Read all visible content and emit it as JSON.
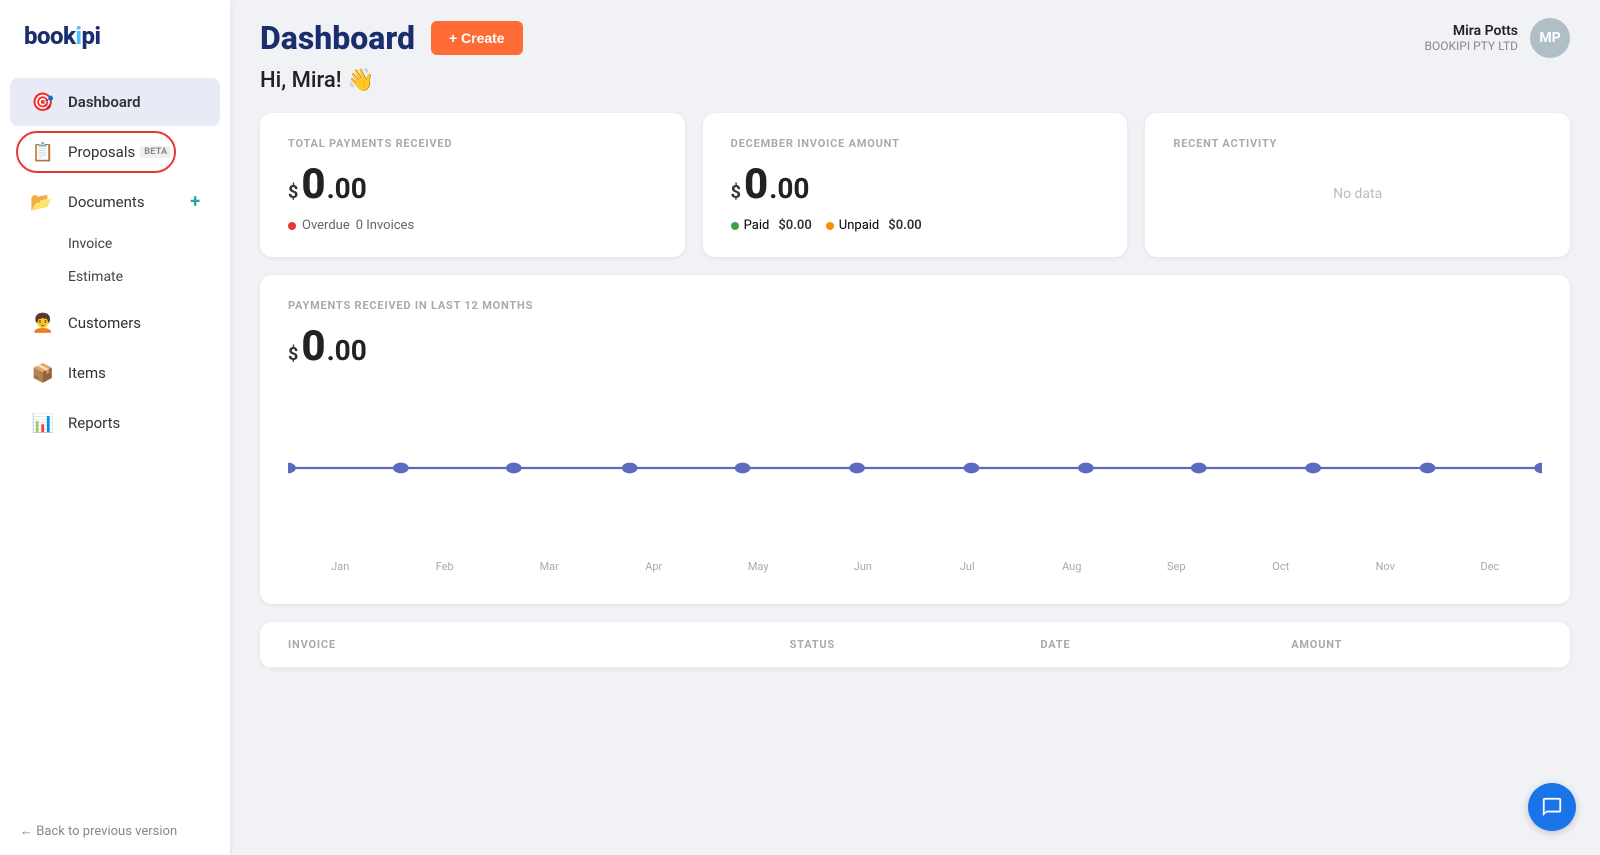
{
  "app": {
    "logo": "bookipi",
    "logo_accent": "i"
  },
  "sidebar": {
    "items": [
      {
        "id": "dashboard",
        "label": "Dashboard",
        "icon": "🎯",
        "active": true
      },
      {
        "id": "proposals",
        "label": "Proposals",
        "icon": "📋",
        "badge": "BETA",
        "circled": true
      },
      {
        "id": "documents",
        "label": "Documents",
        "icon": "📂",
        "has_plus": true
      },
      {
        "id": "invoice",
        "label": "Invoice",
        "sub": true
      },
      {
        "id": "estimate",
        "label": "Estimate",
        "sub": true
      },
      {
        "id": "customers",
        "label": "Customers",
        "icon": "🧑‍🦱"
      },
      {
        "id": "items",
        "label": "Items",
        "icon": "📦"
      },
      {
        "id": "reports",
        "label": "Reports",
        "icon": "📊"
      }
    ],
    "back_label": "← Back to previous version"
  },
  "header": {
    "title": "Dashboard",
    "create_btn": "+ Create"
  },
  "user": {
    "name": "Mira Potts",
    "company": "BOOKIPI PTY LTD",
    "initials": "MP"
  },
  "greeting": "Hi, Mira! 👋",
  "cards": {
    "total_payments": {
      "title": "TOTAL PAYMENTS RECEIVED",
      "amount_dollar": "$",
      "amount_big": "0",
      "amount_decimal": ".00",
      "overdue_dot": "red",
      "overdue_label": "Overdue",
      "overdue_count": "0 Invoices"
    },
    "december_invoice": {
      "title": "DECEMBER INVOICE AMOUNT",
      "amount_dollar": "$",
      "amount_big": "0",
      "amount_decimal": ".00",
      "paid_label": "Paid",
      "paid_amount": "$0.00",
      "unpaid_label": "Unpaid",
      "unpaid_amount": "$0.00"
    },
    "recent_activity": {
      "title": "RECENT ACTIVITY",
      "empty_label": "No data"
    }
  },
  "chart": {
    "title": "PAYMENTS RECEIVED IN LAST 12 MONTHS",
    "amount_dollar": "$",
    "amount_big": "0",
    "amount_decimal": ".00",
    "months": [
      "Jan",
      "Feb",
      "Mar",
      "Apr",
      "May",
      "Jun",
      "Jul",
      "Aug",
      "Sep",
      "Oct",
      "Nov",
      "Dec"
    ],
    "values": [
      0,
      0,
      0,
      0,
      0,
      0,
      0,
      0,
      0,
      0,
      0,
      0
    ]
  },
  "table": {
    "columns": [
      "INVOICE",
      "STATUS",
      "DATE",
      "AMOUNT"
    ]
  }
}
